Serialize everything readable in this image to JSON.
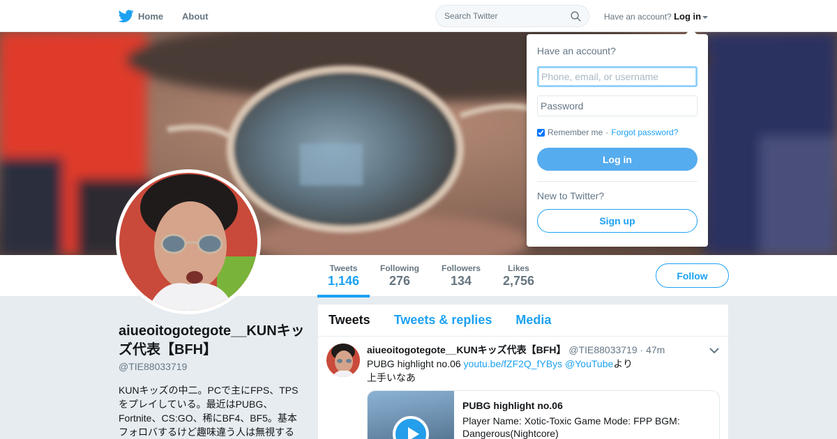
{
  "nav": {
    "home_label": "Home",
    "about_label": "About",
    "search_placeholder": "Search Twitter",
    "have_account_text": "Have an account?",
    "login_label": "Log in"
  },
  "profile": {
    "name": "aiueoitogotegote__KUNキッズ代表【BFH】",
    "handle": "@TIE88033719",
    "bio": "KUNキッズの中二。PCで主にFPS、TPSをプレイしている。最近はPUBG、Fortnite、CS:GO、稀にBF4、BF5。基本フォロバするけど趣味違う人は無視する",
    "follow_label": "Follow"
  },
  "stats": [
    {
      "label": "Tweets",
      "value": "1,146"
    },
    {
      "label": "Following",
      "value": "276"
    },
    {
      "label": "Followers",
      "value": "134"
    },
    {
      "label": "Likes",
      "value": "2,756"
    }
  ],
  "timeline": {
    "tabs": [
      "Tweets",
      "Tweets & replies",
      "Media"
    ],
    "tweet": {
      "name": "aiueoitogotegote__KUNキッズ代表【BFH】",
      "handle": "@TIE88033719",
      "time": "· 47m",
      "text_prefix": "PUBG highlight no.06 ",
      "link1": "youtu.be/fZF2Q_fYBys",
      "link2": "@YouTube",
      "text_suffix": "より",
      "line2": "上手いなあ",
      "card_title": "PUBG highlight no.06",
      "card_desc": "Player Name: Xotic-Toxic Game Mode: FPP BGM: Dangerous(Nightcore)"
    }
  },
  "login_dropdown": {
    "title": "Have an account?",
    "username_placeholder": "Phone, email, or username",
    "password_placeholder": "Password",
    "remember_label": "Remember me",
    "separator": "·",
    "forgot_label": "Forgot password?",
    "login_button": "Log in",
    "new_text": "New to Twitter?",
    "signup_button": "Sign up"
  },
  "colors": {
    "accent": "#1da1f2",
    "login_button": "#55acee",
    "background": "#e6ecf0"
  }
}
